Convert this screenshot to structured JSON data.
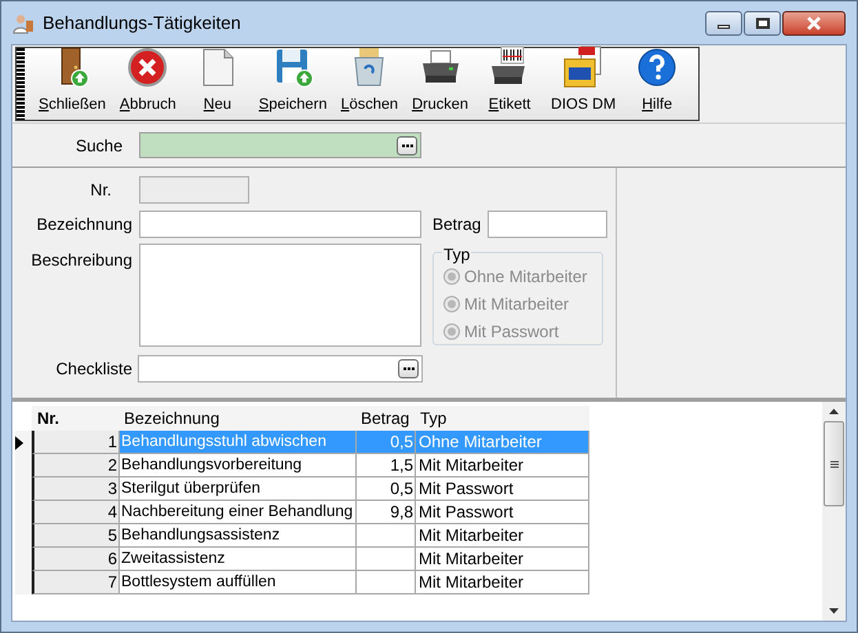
{
  "window": {
    "title": "Behandlungs-Tätigkeiten"
  },
  "toolbar": [
    {
      "kind": "door",
      "label": "Schließen",
      "access_key": true
    },
    {
      "kind": "cancel",
      "label": "Abbruch",
      "access_key": true
    },
    {
      "kind": "new",
      "label": "Neu",
      "access_key": true
    },
    {
      "kind": "save",
      "label": "Speichern",
      "access_key": true
    },
    {
      "kind": "trash",
      "label": "Löschen",
      "access_key": true
    },
    {
      "kind": "print",
      "label": "Drucken",
      "access_key": true
    },
    {
      "kind": "label",
      "label": "Etikett",
      "access_key": true
    },
    {
      "kind": "dms",
      "label": "DIOS DM",
      "access_key": false
    },
    {
      "kind": "help",
      "label": "Hilfe",
      "access_key": true
    }
  ],
  "search": {
    "label": "Suche"
  },
  "form": {
    "nr_label": "Nr.",
    "name_label": "Bezeichnung",
    "amount_label": "Betrag",
    "description_label": "Beschreibung",
    "checklist_label": "Checkliste",
    "type_group": {
      "title": "Typ",
      "disabled": true,
      "options": [
        {
          "label": "Ohne Mitarbeiter",
          "selected": false
        },
        {
          "label": "Mit Mitarbeiter",
          "selected": false
        },
        {
          "label": "Mit Passwort",
          "selected": false
        }
      ]
    }
  },
  "table": {
    "columns": [
      "Nr.",
      "Bezeichnung",
      "Betrag",
      "Typ"
    ],
    "rows": [
      {
        "nr": "1",
        "name": "Behandlungsstuhl abwischen",
        "amount": "0,5",
        "type": "Ohne Mitarbeiter",
        "selected": true
      },
      {
        "nr": "2",
        "name": "Behandlungsvorbereitung",
        "amount": "1,5",
        "type": "Mit Mitarbeiter",
        "selected": false
      },
      {
        "nr": "3",
        "name": "Sterilgut überprüfen",
        "amount": "0,5",
        "type": "Mit Passwort",
        "selected": false
      },
      {
        "nr": "4",
        "name": "Nachbereitung einer Behandlung",
        "amount": "9,8",
        "type": "Mit Passwort",
        "selected": false
      },
      {
        "nr": "5",
        "name": "Behandlungsassistenz",
        "type": "Mit Mitarbeiter",
        "selected": false
      },
      {
        "nr": "6",
        "name": "Zweitassistenz",
        "type": "Mit Mitarbeiter",
        "selected": false
      },
      {
        "nr": "7",
        "name": "Bottlesystem auffüllen",
        "type": "Mit Mitarbeiter",
        "selected": false
      }
    ]
  }
}
